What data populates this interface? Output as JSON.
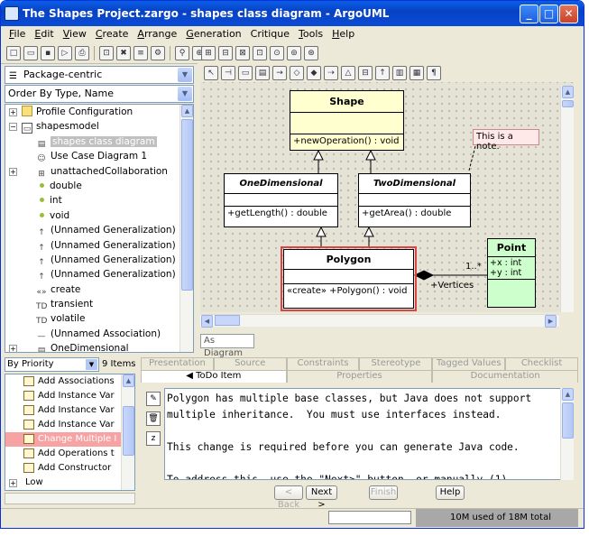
{
  "window": {
    "title": "The Shapes Project.zargo - shapes class diagram - ArgoUML",
    "minimize": "_",
    "maximize": "□",
    "close": "✕"
  },
  "menu": [
    {
      "u": "F",
      "rest": "ile"
    },
    {
      "u": "E",
      "rest": "dit"
    },
    {
      "u": "V",
      "rest": "iew"
    },
    {
      "u": "C",
      "rest": "reate"
    },
    {
      "u": "A",
      "rest": "rrange"
    },
    {
      "u": "G",
      "rest": "eneration"
    },
    {
      "u": "",
      "rest": "Critique"
    },
    {
      "u": "T",
      "rest": "ools"
    },
    {
      "u": "H",
      "rest": "elp"
    }
  ],
  "explorer": {
    "perspective": "Package-centric",
    "order": "Order By Type, Name",
    "tree": [
      {
        "label": "Profile Configuration",
        "icon": "folder-icon",
        "exp": "+",
        "indent": 0
      },
      {
        "label": "shapesmodel",
        "icon": "package-icon",
        "exp": "−",
        "indent": 0
      },
      {
        "label": "shapes class diagram",
        "icon": "class-diagram-icon",
        "indent": 1,
        "selected": true
      },
      {
        "label": "Use Case Diagram 1",
        "icon": "usecase-diagram-icon",
        "indent": 1
      },
      {
        "label": "unattachedCollaboration",
        "icon": "collaboration-icon",
        "exp": "+",
        "indent": 1
      },
      {
        "label": "double",
        "icon": "datatype-icon",
        "indent": 1
      },
      {
        "label": "int",
        "icon": "datatype-icon",
        "indent": 1
      },
      {
        "label": "void",
        "icon": "datatype-icon",
        "indent": 1
      },
      {
        "label": "(Unnamed Generalization)",
        "icon": "generalization-icon",
        "indent": 1
      },
      {
        "label": "(Unnamed Generalization)",
        "icon": "generalization-icon",
        "indent": 1
      },
      {
        "label": "(Unnamed Generalization)",
        "icon": "generalization-icon",
        "indent": 1
      },
      {
        "label": "(Unnamed Generalization)",
        "icon": "generalization-icon",
        "indent": 1
      },
      {
        "label": "create",
        "icon": "stereotype-icon",
        "indent": 1
      },
      {
        "label": "transient",
        "icon": "tagdef-icon",
        "indent": 1
      },
      {
        "label": "volatile",
        "icon": "tagdef-icon",
        "indent": 1
      },
      {
        "label": "(Unnamed Association)",
        "icon": "association-icon",
        "indent": 1
      },
      {
        "label": "OneDimensional",
        "icon": "class-icon",
        "exp": "+",
        "indent": 1
      }
    ]
  },
  "diagram": {
    "tab": "As Diagram",
    "shape": {
      "name": "Shape",
      "op": "+newOperation() : void"
    },
    "one": {
      "name": "OneDimensional",
      "op": "+getLength() : double"
    },
    "two": {
      "name": "TwoDimensional",
      "op": "+getArea() : double"
    },
    "polygon": {
      "name": "Polygon",
      "op": "«create» +Polygon() : void"
    },
    "point": {
      "name": "Point",
      "attr1": "+x : int",
      "attr2": "+y : int"
    },
    "note": "This is a note.",
    "mult": "1..*",
    "role": "+Vertices"
  },
  "todo": {
    "group": "By Priority",
    "count": "9 Items",
    "items": [
      "Add Associations",
      "Add Instance Var",
      "Add Instance Var",
      "Add Instance Var",
      "Change Multiple I",
      "Add Operations t",
      "Add Constructor"
    ],
    "selected_index": 4,
    "low": "Low"
  },
  "details": {
    "tabs_top": [
      "Presentation",
      "Source",
      "Constraints",
      "Stereotype",
      "Tagged Values",
      "Checklist"
    ],
    "tabs_bottom": [
      "◀ ToDo Item",
      "Properties",
      "Documentation"
    ],
    "text": "Polygon has multiple base classes, but Java does not support\nmultiple inheritance.  You must use interfaces instead.\n\nThis change is required before you can generate Java code.\n\nTo address this, use the \"Next>\" button, or manually (1)",
    "back": "< Back",
    "next": "Next >",
    "finish": "Finish",
    "help": "Help"
  },
  "status": {
    "memory": "10M used of 18M total"
  }
}
